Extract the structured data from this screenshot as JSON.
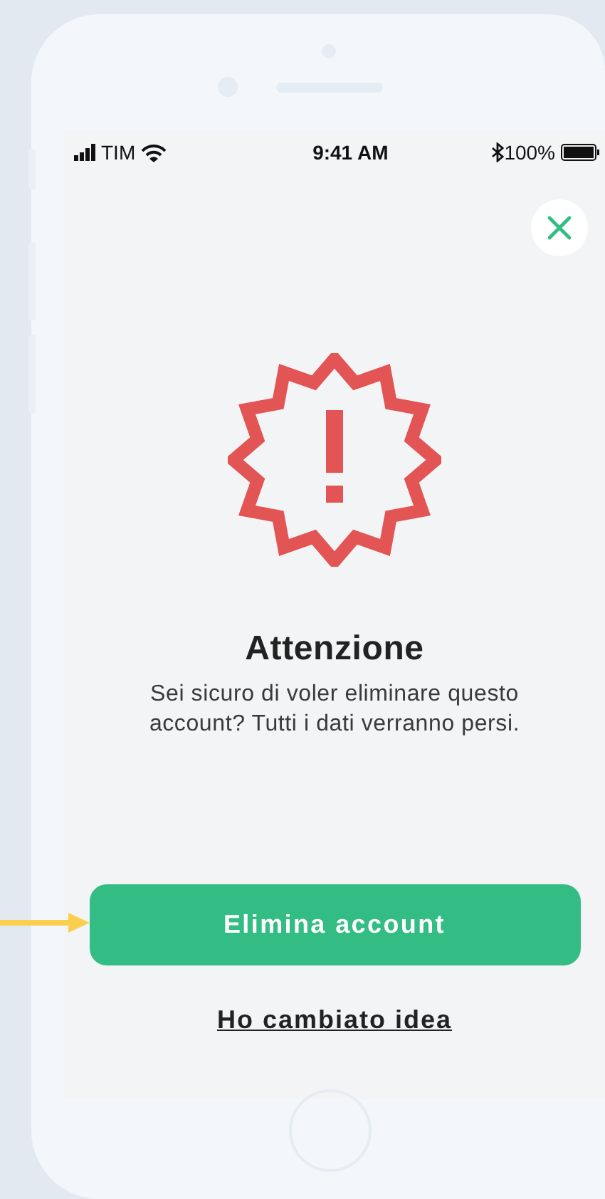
{
  "status_bar": {
    "carrier": "TIM",
    "time": "9:41 AM",
    "battery": "100%"
  },
  "dialog": {
    "title": "Attenzione",
    "message": "Sei sicuro di voler eliminare questo account? Tutti i dati verranno persi.",
    "primary_button": "Elimina account",
    "secondary_link": "Ho cambiato idea"
  }
}
